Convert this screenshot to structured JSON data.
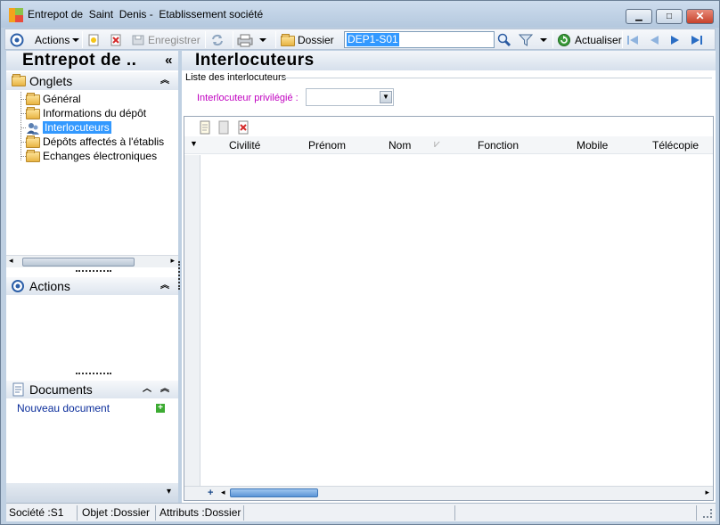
{
  "window": {
    "title": "Entrepot de  Saint  Denis -  Etablissement société",
    "minimize_glyph": "▁",
    "maximize_glyph": "□",
    "close_glyph": "✕"
  },
  "toolbar": {
    "actions_label": "Actions",
    "save_label": "Enregistrer",
    "dossier_label": "Dossier",
    "dossier_value": "DEP1-S01",
    "refresh_label": "Actualiser"
  },
  "left_panel": {
    "header_title": "Entrepot de  ..",
    "collapse_glyph": "«",
    "tabs_section": {
      "title": "Onglets",
      "items": [
        {
          "label": "Général"
        },
        {
          "label": "Informations du dépôt"
        },
        {
          "label": "Interlocuteurs",
          "selected": true
        },
        {
          "label": "Dépôts affectés à l'établis"
        },
        {
          "label": "Echanges électroniques"
        }
      ]
    },
    "actions_section": {
      "title": "Actions"
    },
    "documents_section": {
      "title": "Documents",
      "new_document_label": "Nouveau document"
    }
  },
  "main": {
    "title": "Interlocuteurs",
    "group_label": "Liste des interlocuteurs",
    "privileged_label": "Interlocuteur privilégié :",
    "privileged_value": "",
    "columns": [
      "Civilité",
      "Prénom",
      "Nom",
      "Fonction",
      "Mobile",
      "Télécopie"
    ],
    "rows": []
  },
  "status": {
    "company": "Société :S1",
    "object": "Objet :Dossier",
    "attributes": "Attributs :Dossier"
  },
  "colors": {
    "selection": "#3399ff",
    "privileged_label": "#c000c0",
    "link": "#0b2d9b"
  }
}
